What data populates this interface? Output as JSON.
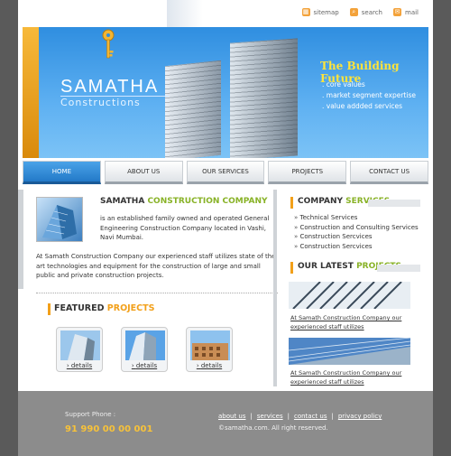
{
  "toplinks": [
    {
      "label": "sitemap",
      "icon": "sitemap-icon"
    },
    {
      "label": "search",
      "icon": "search-icon"
    },
    {
      "label": "mail",
      "icon": "mail-icon"
    }
  ],
  "banner": {
    "logo_main": "SAMATHA",
    "logo_sub": "Constructions",
    "tagline": "The Building Future",
    "bullets": [
      ". core values",
      ". market segment expertise",
      ". value addded services"
    ]
  },
  "nav": [
    "HOME",
    "ABOUT US",
    "OUR SERVICES",
    "PROJECTS",
    "CONTACT US"
  ],
  "company": {
    "title_a": "SAMATHA ",
    "title_b": "CONSTRUCTION COMPANY",
    "intro": "is an established family owned and operated General Engineering Construction Company located in Vashi, Navi Mumbai.",
    "para": "At Samath Construction Company our experienced staff utilizes state of the art technologies and equipment for the construction of large and small public and private construction projects."
  },
  "featured": {
    "title_a": "FEATURED ",
    "title_b": "PROJECTS",
    "link": "details"
  },
  "services": {
    "title_a": "COMPANY ",
    "title_b": "SERVICES",
    "items": [
      "Technical Services",
      "Construction and Consulting Services",
      "Construction Sercvices",
      "Construction Sercvices"
    ]
  },
  "latest": {
    "title_a": "OUR LATEST ",
    "title_b": "PROJECTS",
    "caption": "At Samath Construction Company our experienced staff utilizes"
  },
  "footer": {
    "support_label": "Support Phone :",
    "phone": "91 990 00 00 001",
    "links": [
      "about us",
      "services",
      "contact us",
      "privacy policy"
    ],
    "copyright": "©samatha.com. All right reserved."
  },
  "colors": {
    "accent_green": "#88b226",
    "accent_orange": "#f2a01a",
    "nav_active": "#2379c8",
    "footer_bg": "#8c8c8c"
  }
}
